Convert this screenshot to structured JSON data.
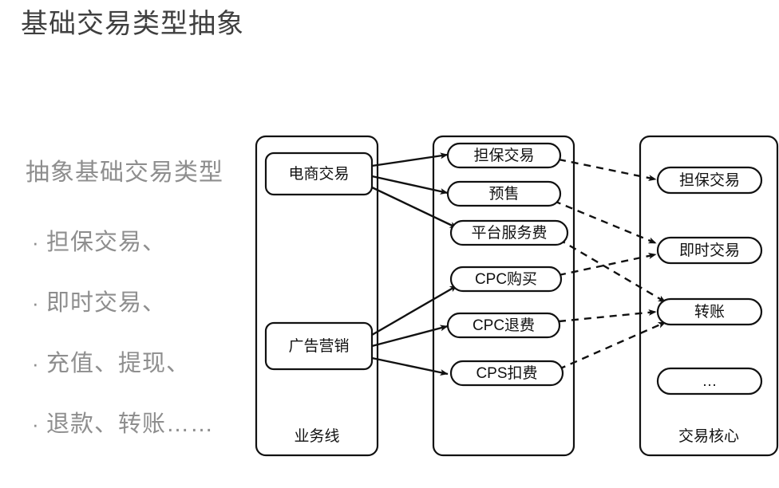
{
  "title": "基础交易类型抽象",
  "left_panel": {
    "heading": "抽象基础交易类型",
    "bullet_marker": "·",
    "bullets": [
      "担保交易、",
      "即时交易、",
      "充值、提现、",
      "退款、转账……"
    ]
  },
  "diagram": {
    "lanes": [
      {
        "id": "business-line",
        "label": "业务线"
      },
      {
        "id": "middle-lane",
        "label": ""
      },
      {
        "id": "trade-core",
        "label": "交易核心"
      }
    ],
    "business_line_nodes": [
      {
        "id": "ecommerce-trade",
        "label": "电商交易"
      },
      {
        "id": "ad-marketing",
        "label": "广告营销"
      }
    ],
    "middle_nodes": [
      {
        "id": "escrow-trade-mid",
        "label": "担保交易"
      },
      {
        "id": "presale",
        "label": "预售"
      },
      {
        "id": "platform-service-fee",
        "label": "平台服务费"
      },
      {
        "id": "cpc-purchase",
        "label": "CPC购买"
      },
      {
        "id": "cpc-refund",
        "label": "CPC退费"
      },
      {
        "id": "cps-deduction",
        "label": "CPS扣费"
      }
    ],
    "trade_core_nodes": [
      {
        "id": "escrow-trade-core",
        "label": "担保交易"
      },
      {
        "id": "instant-trade",
        "label": "即时交易"
      },
      {
        "id": "transfer",
        "label": "转账"
      },
      {
        "id": "ellipsis",
        "label": "…"
      }
    ],
    "solid_links": [
      {
        "from": "电商交易",
        "to": "担保交易"
      },
      {
        "from": "电商交易",
        "to": "预售"
      },
      {
        "from": "电商交易",
        "to": "平台服务费"
      },
      {
        "from": "广告营销",
        "to": "CPC购买"
      },
      {
        "from": "广告营销",
        "to": "CPC退费"
      },
      {
        "from": "广告营销",
        "to": "CPS扣费"
      }
    ],
    "dashed_links": [
      {
        "from": "担保交易",
        "to": "担保交易"
      },
      {
        "from": "预售",
        "to": "即时交易"
      },
      {
        "from": "平台服务费",
        "to": "转账"
      },
      {
        "from": "CPC购买",
        "to": "即时交易"
      },
      {
        "from": "CPC退费",
        "to": "转账"
      },
      {
        "from": "CPS扣费",
        "to": "转账"
      }
    ]
  },
  "colors": {
    "title": "#3f3f3f",
    "left_text": "#8e8e8e",
    "stroke": "#111111",
    "background": "#ffffff"
  }
}
